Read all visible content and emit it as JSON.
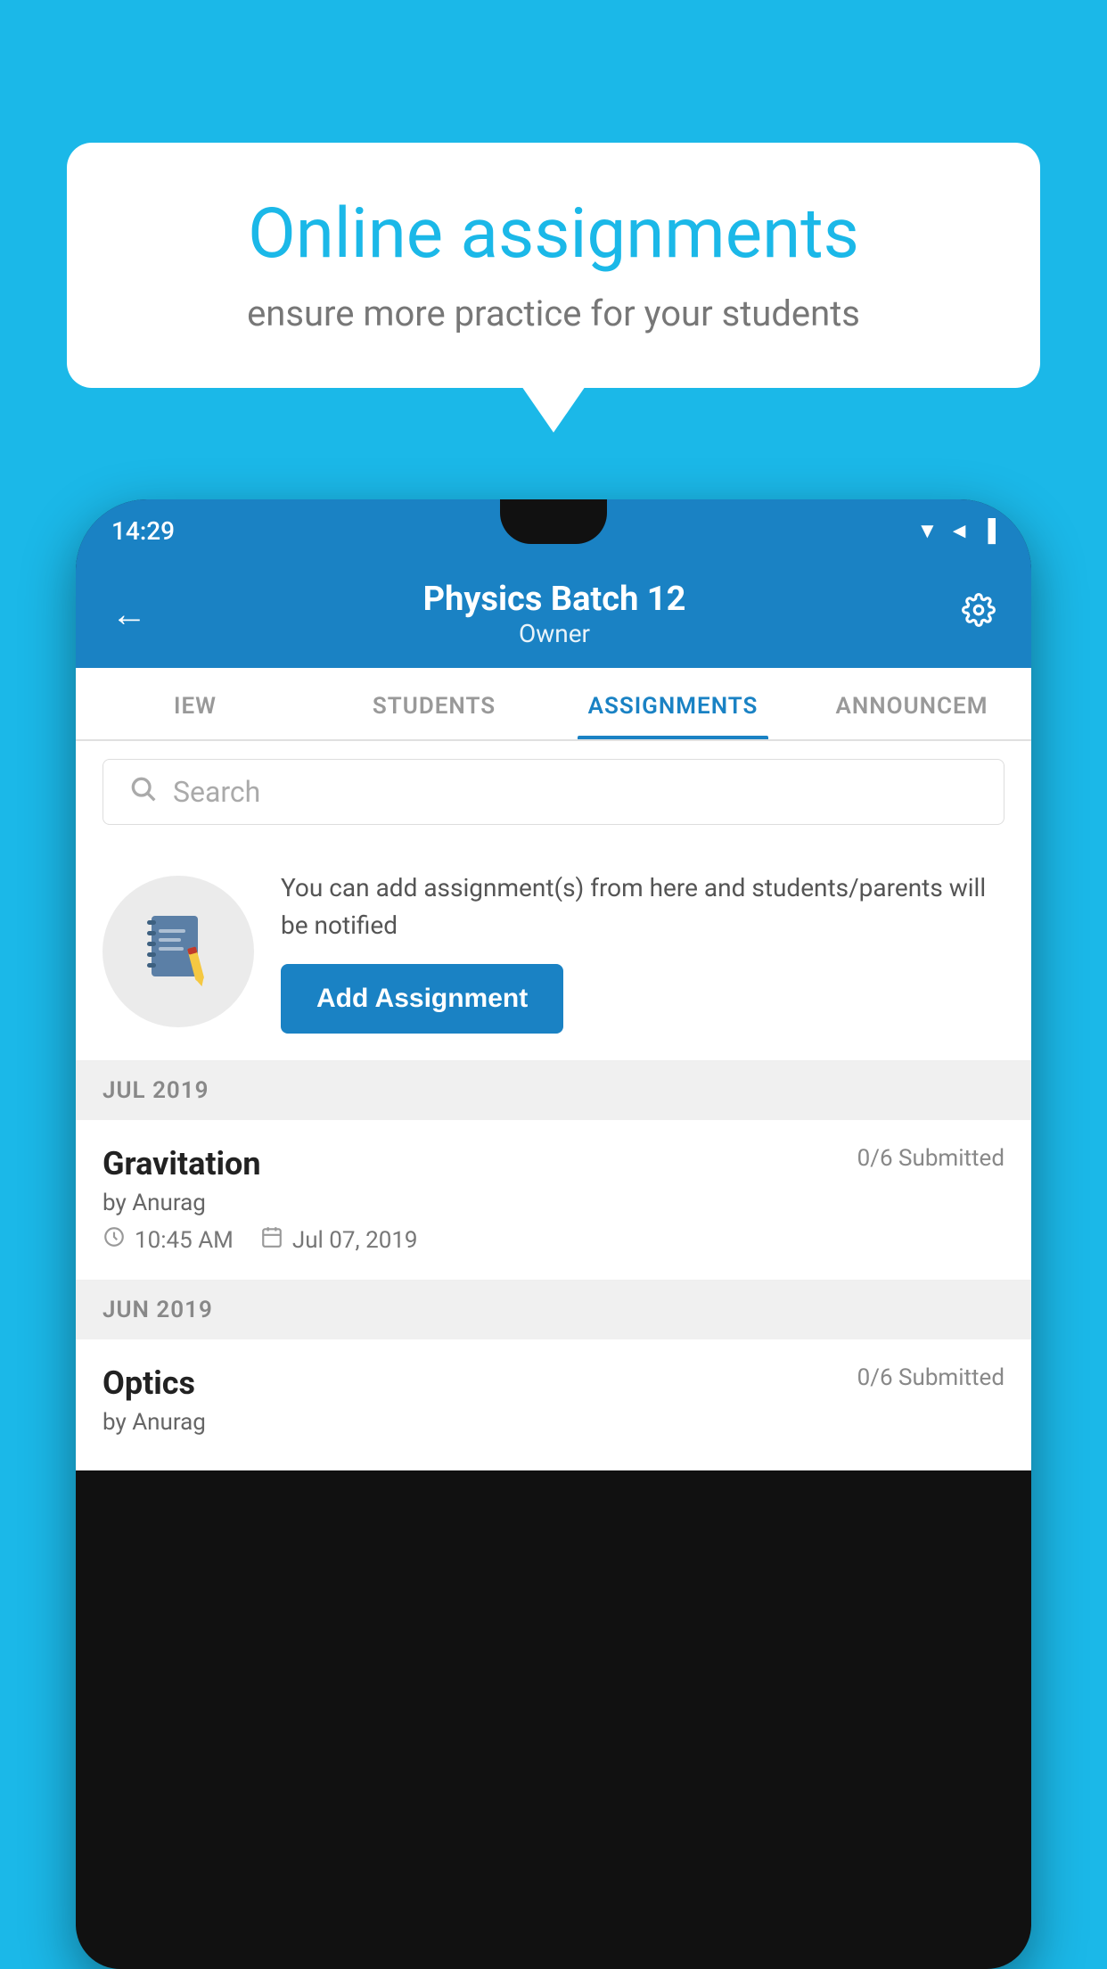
{
  "background_color": "#1BB8E8",
  "speech_bubble": {
    "title": "Online assignments",
    "subtitle": "ensure more practice for your students"
  },
  "status_bar": {
    "time": "14:29",
    "icons": [
      "▼",
      "◀",
      "▐"
    ]
  },
  "header": {
    "title": "Physics Batch 12",
    "subtitle": "Owner",
    "back_label": "←",
    "settings_label": "⚙"
  },
  "tabs": [
    {
      "label": "IEW",
      "active": false
    },
    {
      "label": "STUDENTS",
      "active": false
    },
    {
      "label": "ASSIGNMENTS",
      "active": true
    },
    {
      "label": "ANNOUNCEM",
      "active": false
    }
  ],
  "search": {
    "placeholder": "Search"
  },
  "promo": {
    "text": "You can add assignment(s) from here and students/parents will be notified",
    "button_label": "Add Assignment"
  },
  "sections": [
    {
      "month": "JUL 2019",
      "assignments": [
        {
          "title": "Gravitation",
          "submitted": "0/6 Submitted",
          "author": "by Anurag",
          "time": "10:45 AM",
          "date": "Jul 07, 2019"
        }
      ]
    },
    {
      "month": "JUN 2019",
      "assignments": [
        {
          "title": "Optics",
          "submitted": "0/6 Submitted",
          "author": "by Anurag",
          "time": "",
          "date": ""
        }
      ]
    }
  ]
}
